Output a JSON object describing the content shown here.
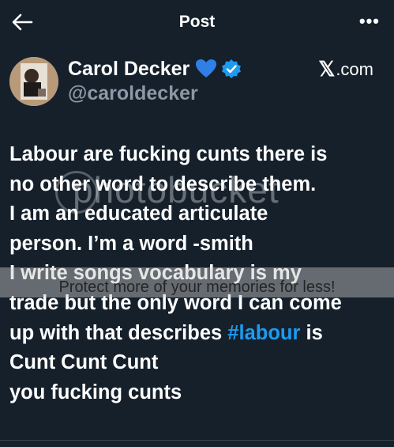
{
  "header": {
    "title": "Post",
    "more_label": "•••"
  },
  "author": {
    "display_name": "Carol Decker",
    "emoji": "💙",
    "handle": "@caroldecker",
    "source_site": ".com",
    "source_logo": "𝕏"
  },
  "tweet": {
    "lines": [
      "Labour are fucking cunts there is",
      "no other word to describe them.",
      "I am an educated articulate",
      "person. I’m a word -smith",
      "I write songs vocabulary is my",
      "trade but the only word I can come"
    ],
    "line7_prefix": "up with that describes ",
    "hashtag": "#labour",
    "line7_suffix": " is",
    "line8": "Cunt Cunt Cunt",
    "line9": "you fucking cunts"
  },
  "watermark": {
    "logo_text": "photobucket",
    "banner_text": "Protect more of your memories for less!"
  },
  "colors": {
    "background": "#15202b",
    "link": "#1d9bf0",
    "muted": "#8b98a5",
    "verified": "#1d9bf0"
  },
  "icons": {
    "back": "arrow-left-icon",
    "verified": "verified-badge-icon",
    "more": "more-horizontal-icon"
  }
}
